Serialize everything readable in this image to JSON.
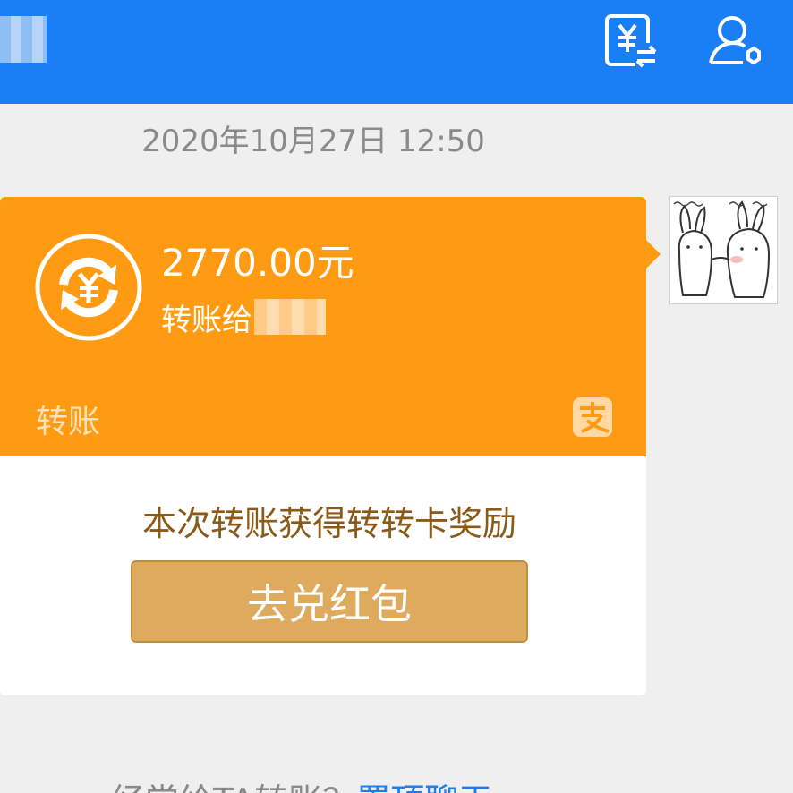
{
  "header": {
    "title": "",
    "transfer_icon": "yuan-transfer-icon",
    "profile_icon": "user-settings-icon",
    "background_color": "#1a7ff4"
  },
  "chat": {
    "timestamp": "2020年10月27日 12:50"
  },
  "transfer_card": {
    "amount": "2770.00元",
    "recipient_label": "转账给",
    "type_label": "转账",
    "accent_color": "#ff9b12",
    "reward_text": "本次转账获得转转卡奖励",
    "redeem_button_label": "去兑红包"
  },
  "bottom_hint": {
    "text": "经常给TA转账？",
    "link_text": "置顶聊天"
  }
}
